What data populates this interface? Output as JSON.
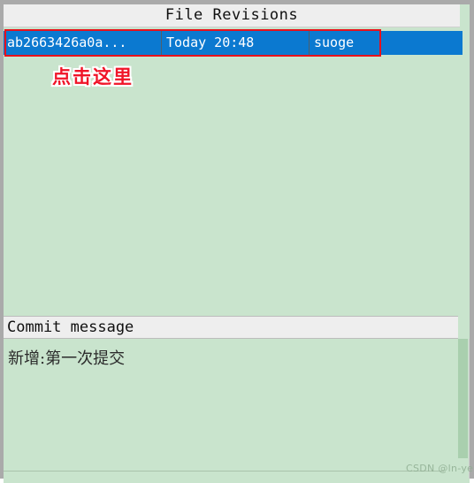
{
  "window": {
    "frame_color": "#aaaaaa",
    "background_color": "#c9e4cd"
  },
  "revisions_panel": {
    "title": "File Revisions",
    "columns": [
      "commit",
      "date",
      "author"
    ],
    "rows": [
      {
        "commit": "ab2663426a0a...",
        "date": "Today 20:48",
        "author": "suoge",
        "selected": true,
        "selection_color": "#0b79d0"
      }
    ]
  },
  "annotations": [
    {
      "type": "rectangle",
      "color": "#e8111c",
      "target": "selected-revision-row"
    },
    {
      "type": "text",
      "text": "点击这里",
      "color": "#f01428",
      "outline_color": "#ffffff"
    }
  ],
  "commit_panel": {
    "header_label": "Commit message",
    "message": "新增:第一次提交"
  },
  "watermark": {
    "text": "CSDN @ln-year"
  }
}
